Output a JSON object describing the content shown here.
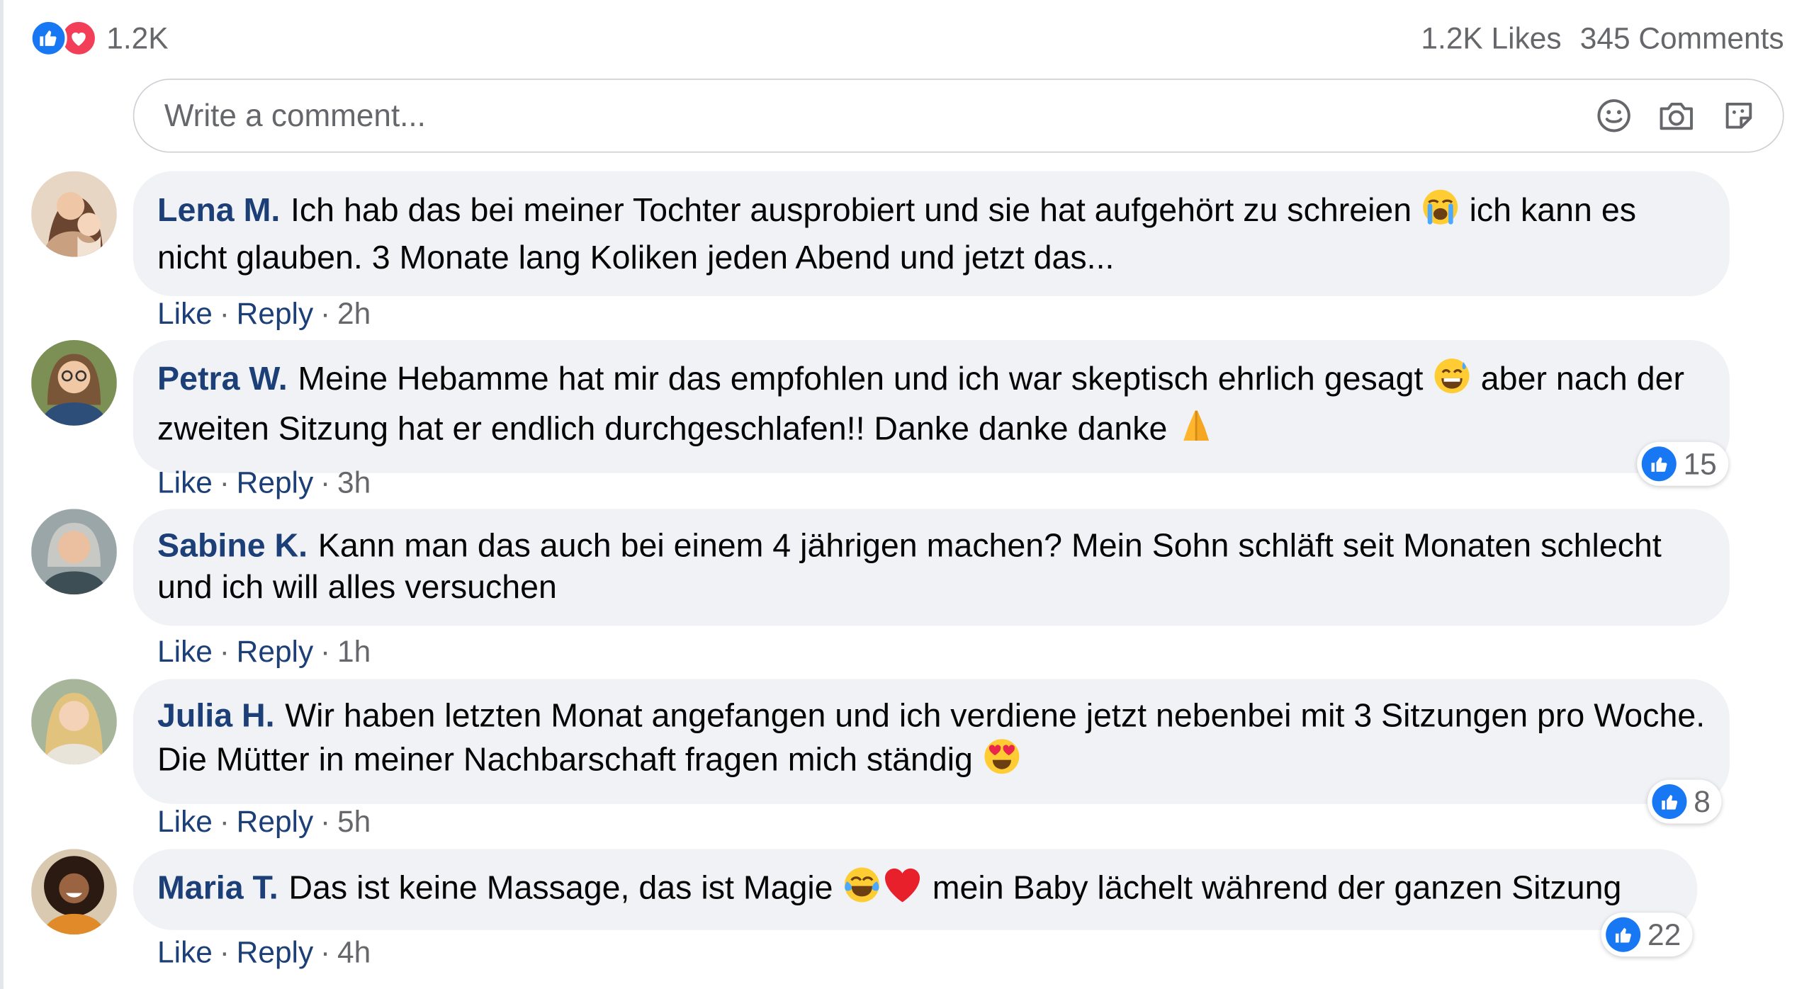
{
  "summary": {
    "reaction_count": "1.2K",
    "likes_text": "1.2K Likes",
    "comments_text": "345 Comments",
    "reaction_icons": [
      "like-icon",
      "love-icon"
    ]
  },
  "composer": {
    "placeholder": "Write a comment...",
    "tools": [
      "emoji-icon",
      "camera-icon",
      "sticker-icon"
    ]
  },
  "actions": {
    "like": "Like",
    "reply": "Reply",
    "separator": "·"
  },
  "colors": {
    "like_blue": "#1877f2",
    "love_red": "#f33e58",
    "bubble": "#f0f2f5",
    "name": "#1c3f78",
    "meta": "#65676b"
  },
  "comments": [
    {
      "author": "Lena M.",
      "text_1": "Ich hab das bei meiner Tochter ausprobiert und sie hat aufgehört zu schreien",
      "emoji_1": "crying-face-emoji",
      "text_2": "ich kann es nicht glauben. 3 Monate lang Koliken jeden Abend und jetzt das...",
      "time": "2h",
      "avatar": "mother-with-baby-avatar"
    },
    {
      "author": "Petra W.",
      "text_1": "Meine Hebamme hat mir das empfohlen und ich war skeptisch ehrlich gesagt",
      "emoji_1": "grinning-sweat-emoji",
      "text_2": "aber nach der zweiten Sitzung hat er endlich durchgeschlafen!! Danke danke danke",
      "emoji_2": "folded-hands-emoji",
      "time": "3h",
      "likes": "15",
      "avatar": "woman-with-glasses-avatar"
    },
    {
      "author": "Sabine K.",
      "text_1": "Kann man das auch bei einem 4 jährigen machen? Mein Sohn schläft seit Monaten schlecht und ich will alles versuchen",
      "time": "1h",
      "avatar": "gray-haired-woman-avatar"
    },
    {
      "author": "Julia H.",
      "text_1": "Wir haben letzten Monat angefangen und ich verdiene jetzt nebenbei mit 3 Sitzungen pro Woche. Die Mütter in meiner Nachbarschaft fragen mich ständig",
      "emoji_1": "heart-eyes-emoji",
      "time": "5h",
      "likes": "8",
      "avatar": "blonde-woman-avatar"
    },
    {
      "author": "Maria T.",
      "text_1": "Das ist keine Massage, das ist Magie",
      "emoji_1": "tears-of-joy-emoji",
      "emoji_2": "red-heart-emoji",
      "text_2": "mein Baby lächelt während der ganzen Sitzung",
      "time": "4h",
      "likes": "22",
      "avatar": "curly-haired-woman-avatar"
    }
  ]
}
